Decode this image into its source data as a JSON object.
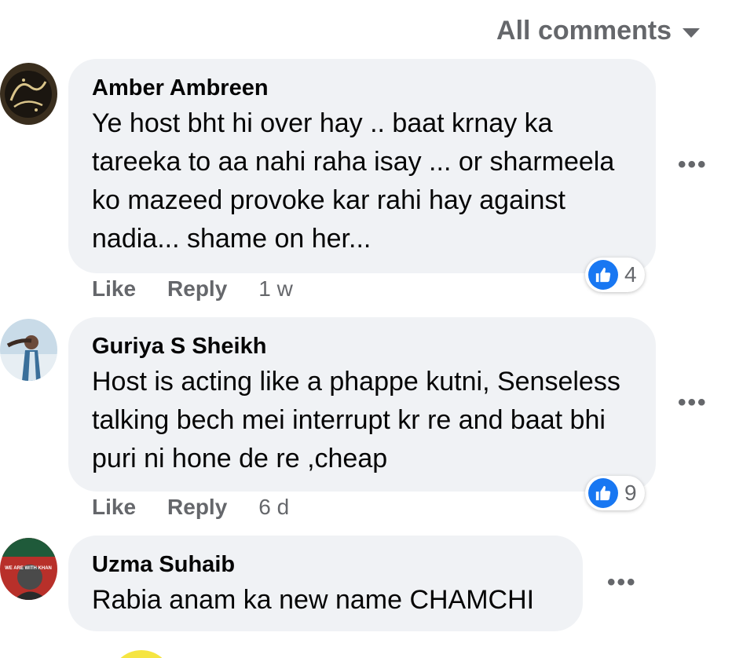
{
  "filter": {
    "label": "All comments"
  },
  "comments": [
    {
      "author": "Amber Ambreen",
      "text": "Ye host bht hi over hay .. baat krnay ka tareeka to aa nahi raha isay ... or sharmeela ko mazeed provoke kar rahi hay against nadia... shame on her...",
      "like_label": "Like",
      "reply_label": "Reply",
      "time": "1 w",
      "reactions": "4",
      "more_label": "•••"
    },
    {
      "author": "Guriya S Sheikh",
      "text": "Host is acting like a phappe kutni, Senseless talking bech mei interrupt kr re and baat bhi puri ni hone de re ,cheap",
      "like_label": "Like",
      "reply_label": "Reply",
      "time": "6 d",
      "reactions": "9",
      "more_label": "•••"
    },
    {
      "author": "Uzma Suhaib",
      "text": "Rabia anam ka new name CHAMCHI",
      "more_label": "•••",
      "avatar_caption": "WE ARE WITH KHAN"
    }
  ],
  "icons": {
    "caret": "chevron-down-icon",
    "like": "thumbs-up-icon",
    "more": "more-options-icon"
  },
  "colors": {
    "accent": "#1877f2",
    "bubble": "#f0f2f5",
    "secondary_text": "#65676b"
  }
}
